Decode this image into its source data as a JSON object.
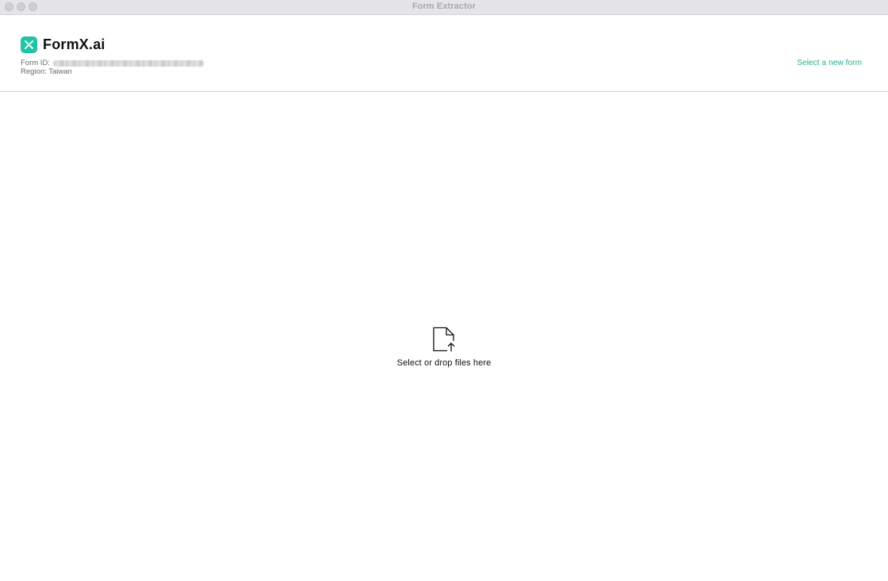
{
  "window": {
    "title": "Form Extractor"
  },
  "header": {
    "brand": "FormX.ai",
    "form_id_label": "Form ID:",
    "region_label": "Region: Taiwan",
    "select_new_form": "Select a new form"
  },
  "dropzone": {
    "label": "Select or drop files here",
    "icon": "file-upload-icon"
  },
  "colors": {
    "accent": "#1ec4a4",
    "link": "#1fae8e",
    "titlebar": "#e5e4e6"
  }
}
